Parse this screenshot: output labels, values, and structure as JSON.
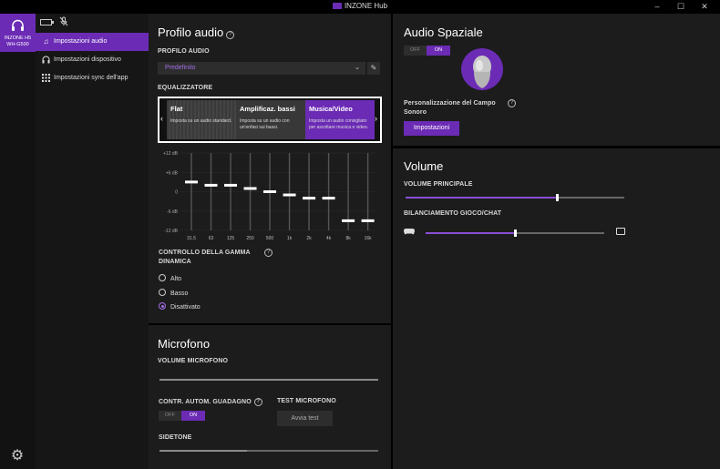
{
  "window": {
    "title": "INZONE Hub",
    "minimize": "–",
    "maximize": "☐",
    "close": "✕"
  },
  "device": {
    "name_line1": "INZONE H5",
    "name_line2": "WH-G500"
  },
  "nav": {
    "items": [
      {
        "label": "Impostazioni audio",
        "icon": "music-note-icon",
        "active": true
      },
      {
        "label": "Impostazioni dispositivo",
        "icon": "headphones-icon",
        "active": false
      },
      {
        "label": "Impostazioni sync dell'app",
        "icon": "grid-icon",
        "active": false
      }
    ]
  },
  "profile": {
    "title": "Profilo audio",
    "section_label": "PROFILO AUDIO",
    "selected": "Predefinito"
  },
  "equalizer": {
    "label": "EQUALIZZATORE",
    "presets": [
      {
        "title": "Flat",
        "desc": "Imposta su un audio standard."
      },
      {
        "title": "Amplificaz. bassi",
        "desc": "Imposta su un audio con un'enfasi sui bassi."
      },
      {
        "title": "Musica/Video",
        "desc": "Imposta un audio consigliato per ascoltare musica e video."
      }
    ],
    "selected_preset": "Musica/Video",
    "db_labels": [
      "+12 dB",
      "+6 dB",
      "0",
      "-6 dB",
      "-12 dB"
    ],
    "bands": [
      "31.5",
      "63",
      "125",
      "250",
      "500",
      "1k",
      "2k",
      "4k",
      "8k",
      "16k"
    ],
    "values_db": [
      3,
      2,
      2,
      1,
      0,
      -1,
      -2,
      -2,
      -9,
      -9
    ],
    "range_db": [
      -12,
      12
    ]
  },
  "dynamic_range": {
    "label_line1": "CONTROLLO DELLA GAMMA",
    "label_line2": "DINAMICA",
    "options": [
      "Alto",
      "Basso",
      "Disattivato"
    ],
    "selected": "Disattivato"
  },
  "microphone": {
    "title": "Microfono",
    "volume_label": "VOLUME MICROFONO",
    "volume_level": 1.0,
    "agc_label": "CONTR. AUTOM. GUADAGNO",
    "agc_off": "OFF",
    "agc_on": "ON",
    "test_label": "TEST MICROFONO",
    "test_button": "Avvia test",
    "sidetone_label": "SIDETONE",
    "sidetone_level": 0.4
  },
  "spatial": {
    "title": "Audio Spaziale",
    "off": "OFF",
    "on": "ON",
    "personalization_line1": "Personalizzazione del Campo",
    "personalization_line2": "Sonoro",
    "settings_button": "Impostazioni"
  },
  "volume": {
    "title": "Volume",
    "master_label": "VOLUME PRINCIPALE",
    "master_level": 0.69,
    "balance_label": "BILANCIAMENTO GIOCO/CHAT",
    "balance_level": 0.5
  },
  "colors": {
    "accent": "#6b2bb5",
    "accent_light": "#a46ee6",
    "panel": "#1c1c1c",
    "background": "#000000"
  }
}
